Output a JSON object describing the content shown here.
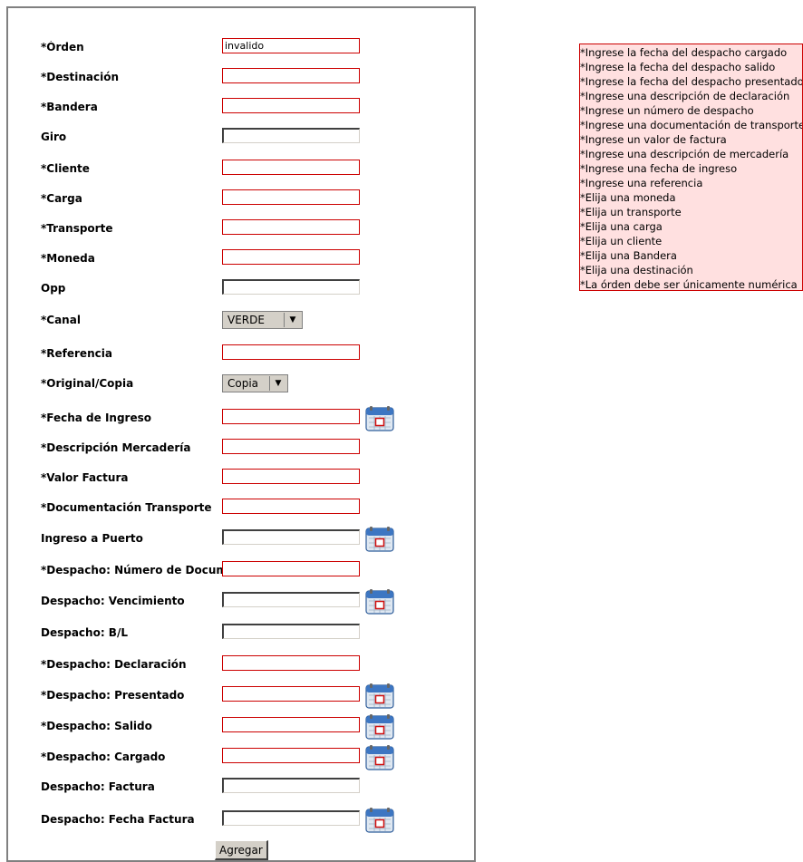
{
  "form": {
    "fields": [
      {
        "label": "*Órden",
        "value": "invalido",
        "error": true
      },
      {
        "label": "*Destinación",
        "value": "",
        "error": true
      },
      {
        "label": "*Bandera",
        "value": "",
        "error": true
      },
      {
        "label": "Giro",
        "value": "",
        "error": false
      },
      {
        "label": "*Cliente",
        "value": "",
        "error": true
      },
      {
        "label": "*Carga",
        "value": "",
        "error": true
      },
      {
        "label": "*Transporte",
        "value": "",
        "error": true
      },
      {
        "label": "*Moneda",
        "value": "",
        "error": true
      },
      {
        "label": "Opp",
        "value": "",
        "error": false
      },
      {
        "label": "*Canal",
        "select": "VERDE"
      },
      {
        "label": "*Referencia",
        "value": "",
        "error": true
      },
      {
        "label": "*Original/Copia",
        "select": "Copia"
      },
      {
        "label": "*Fecha de Ingreso",
        "value": "",
        "error": true,
        "calendar": true
      },
      {
        "label": "*Descripción Mercadería",
        "value": "",
        "error": true
      },
      {
        "label": "*Valor Factura",
        "value": "",
        "error": true
      },
      {
        "label": "*Documentación Transporte",
        "value": "",
        "error": true
      },
      {
        "label": "Ingreso a Puerto",
        "value": "",
        "error": false,
        "calendar": true
      },
      {
        "label": "*Despacho: Número de Documento",
        "value": "",
        "error": true
      },
      {
        "label": "Despacho: Vencimiento",
        "value": "",
        "error": false,
        "calendar": true
      },
      {
        "label": "Despacho: B/L",
        "value": "",
        "error": false
      },
      {
        "label": "*Despacho: Declaración",
        "value": "",
        "error": true
      },
      {
        "label": "*Despacho: Presentado",
        "value": "",
        "error": true,
        "calendar": true
      },
      {
        "label": "*Despacho: Salido",
        "value": "",
        "error": true,
        "calendar": true
      },
      {
        "label": "*Despacho: Cargado",
        "value": "",
        "error": true,
        "calendar": true
      },
      {
        "label": "Despacho: Factura",
        "value": "",
        "error": false
      },
      {
        "label": "Despacho: Fecha Factura",
        "value": "",
        "error": false,
        "calendar": true
      }
    ],
    "submit_label": "Agregar"
  },
  "errors": [
    "*Ingrese la fecha del despacho cargado",
    "*Ingrese la fecha del despacho salido",
    "*Ingrese la fecha del despacho presentado",
    "*Ingrese una descripción de declaración",
    "*Ingrese un número de despacho",
    "*Ingrese una documentación de transporte",
    "*Ingrese un valor de factura",
    "*Ingrese una descripción de mercadería",
    "*Ingrese una fecha de ingreso",
    "*Ingrese una referencia",
    "*Elija una moneda",
    "*Elija un transporte",
    "*Elija una carga",
    "*Elija un cliente",
    "*Elija una Bandera",
    "*Elija una destinación",
    "*La órden debe ser únicamente numérica"
  ],
  "colors": {
    "error_border": "#cc0000",
    "error_background": "#ffe0e0",
    "panel_border": "#808080"
  },
  "icons": {
    "calendar": "calendar-icon",
    "dropdown": "triangle-down-icon"
  }
}
